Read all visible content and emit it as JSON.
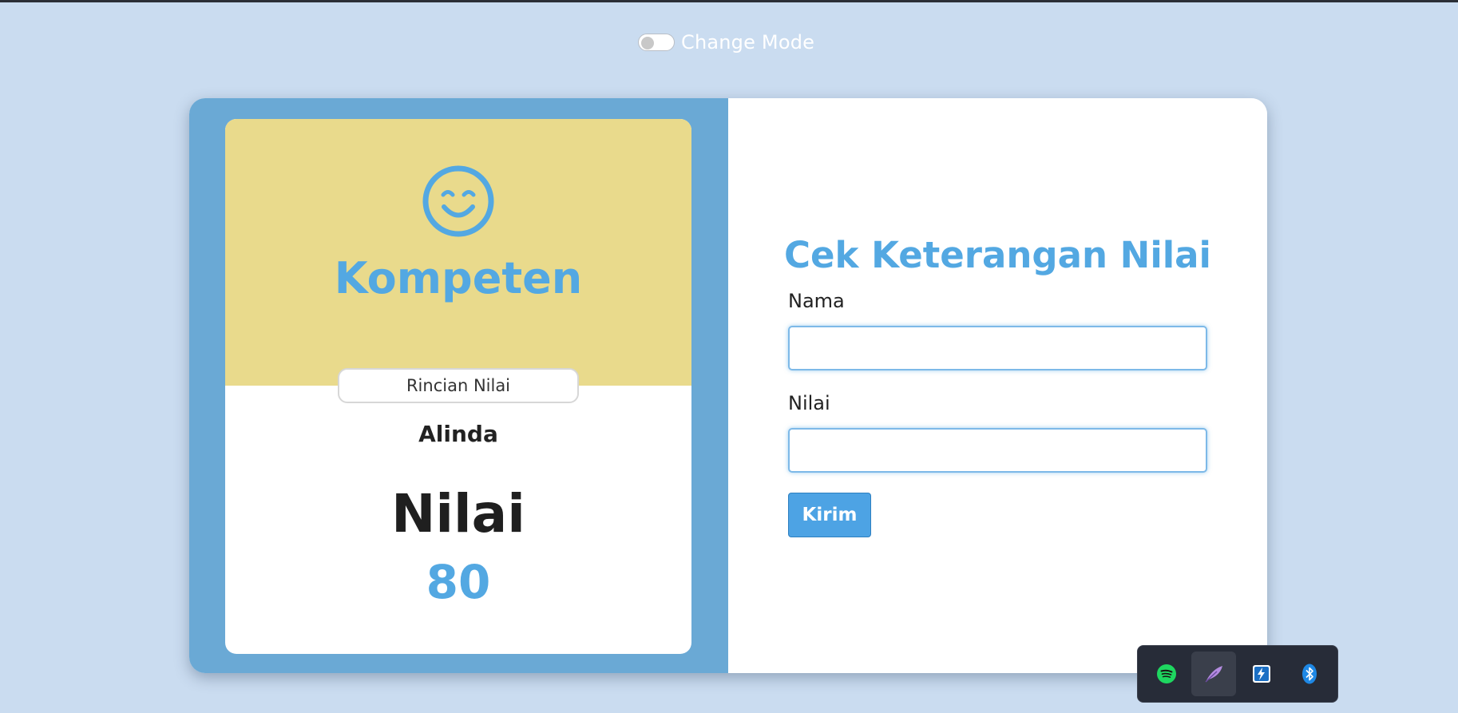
{
  "header": {
    "mode_toggle_label": "Change Mode",
    "mode_toggle_on": false
  },
  "result": {
    "icon": "smile-icon",
    "status": "Kompeten",
    "details_button_label": "Rincian Nilai",
    "student_name": "Alinda",
    "score_heading": "Nilai",
    "score_value": "80"
  },
  "form": {
    "title": "Cek Keterangan Nilai",
    "name_label": "Nama",
    "name_value": "",
    "name_placeholder": "",
    "score_label": "Nilai",
    "score_value": "",
    "score_placeholder": "",
    "submit_label": "Kirim"
  },
  "tray": {
    "items": [
      {
        "icon": "spotify-icon",
        "active": false
      },
      {
        "icon": "feather-icon",
        "active": true
      },
      {
        "icon": "thunderbolt-icon",
        "active": false
      },
      {
        "icon": "bluetooth-icon",
        "active": false
      }
    ]
  },
  "colors": {
    "page_background": "#cadcf0",
    "left_pane": "#6aa9d5",
    "result_top": "#e9da8c",
    "accent_blue": "#53a8e2",
    "button_blue": "#4da3e4"
  }
}
